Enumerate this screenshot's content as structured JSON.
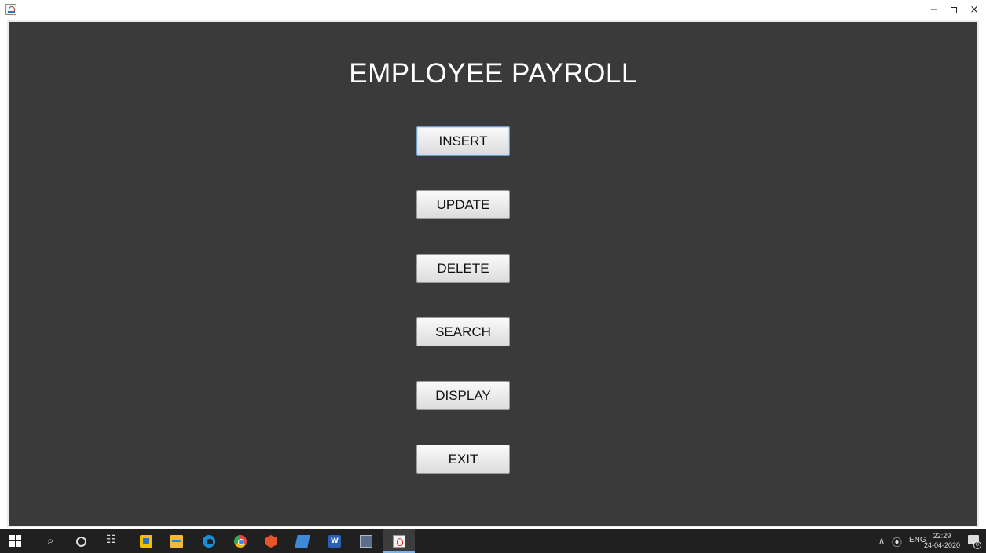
{
  "window": {
    "minimize_glyph": "−",
    "close_glyph": "×"
  },
  "main": {
    "title": "EMPLOYEE PAYROLL",
    "buttons": [
      {
        "label": "INSERT"
      },
      {
        "label": "UPDATE"
      },
      {
        "label": "DELETE"
      },
      {
        "label": "SEARCH"
      },
      {
        "label": "DISPLAY"
      },
      {
        "label": "EXIT"
      }
    ]
  },
  "taskbar": {
    "language": "ENG",
    "time": "22:29",
    "date": "24-04-2020",
    "notification_count": "8",
    "icons": [
      "windows-start-icon",
      "search-icon",
      "cortana-icon",
      "task-view-icon",
      "store-icon",
      "file-explorer-icon",
      "edge-icon",
      "chrome-icon",
      "app-icon",
      "notes-icon",
      "word-icon",
      "monitor-icon",
      "java-app-icon"
    ]
  },
  "colors": {
    "panel_background": "#3a3a3a",
    "title_text": "#ffffff",
    "taskbar": "#202020"
  }
}
